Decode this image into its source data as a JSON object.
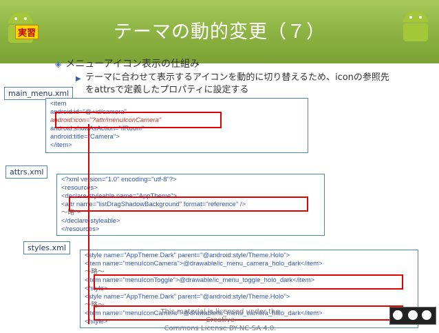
{
  "header": {
    "badge": "実習",
    "title": "テーマの動的変更（７）"
  },
  "bullets": {
    "level1": "メニューアイコン表示の仕組み",
    "level2_line1": "テーマに合わせて表示するアイコンを動的に切り替えるため、iconの参照先",
    "level2_line2": "をattrsで定義したプロパティに設定する"
  },
  "labels": {
    "main_menu": "main_menu.xml",
    "attrs": "attrs.xml",
    "styles": "styles.xml"
  },
  "code": {
    "main_menu": [
      "<item",
      "  android:id=\"@+id/camera\"",
      "  android:icon=\"?attr/menuIconCamera\"",
      "  android:showAsAction=\"ifRoom\"",
      "  android:title=\"Camera\">",
      "</item>"
    ],
    "attrs": [
      "<?xml version=\"1.0\" encoding=\"utf-8\"?>",
      "<resources>",
      "  <declare-styleable name=\"AppTheme\">",
      "    <attr name=\"listDragShadowBackground\" format=\"reference\" />",
      "    ～略～",
      "  </declare-styleable>",
      "</resources>"
    ],
    "styles": [
      "<style name=\"AppTheme.Dark\" parent=\"@android:style/Theme.Holo\">",
      "  <item name=\"menuIconCamera\">@drawable/ic_menu_camera_holo_dark</item>",
      "  ～略～",
      "  <item name=\"menuIconToggle\">@drawable/ic_menu_toggle_holo_dark</item>",
      "</style>",
      "<style name=\"AppTheme.Dark\" parent=\"@android:style/Theme.Holo\">",
      "  ～略～",
      "  <item name=\"menuIconCamera\">@drawable/ic_menu_camera_holo_dark</item>",
      "</style>"
    ]
  },
  "footer": {
    "line1": "This material is licensed under the Creative",
    "line2": "Commons License BY-NC-SA 4.0."
  },
  "colors": {
    "header_green": "#8fb545",
    "highlight_red": "#e00000",
    "box_blue": "#4f81bd"
  }
}
